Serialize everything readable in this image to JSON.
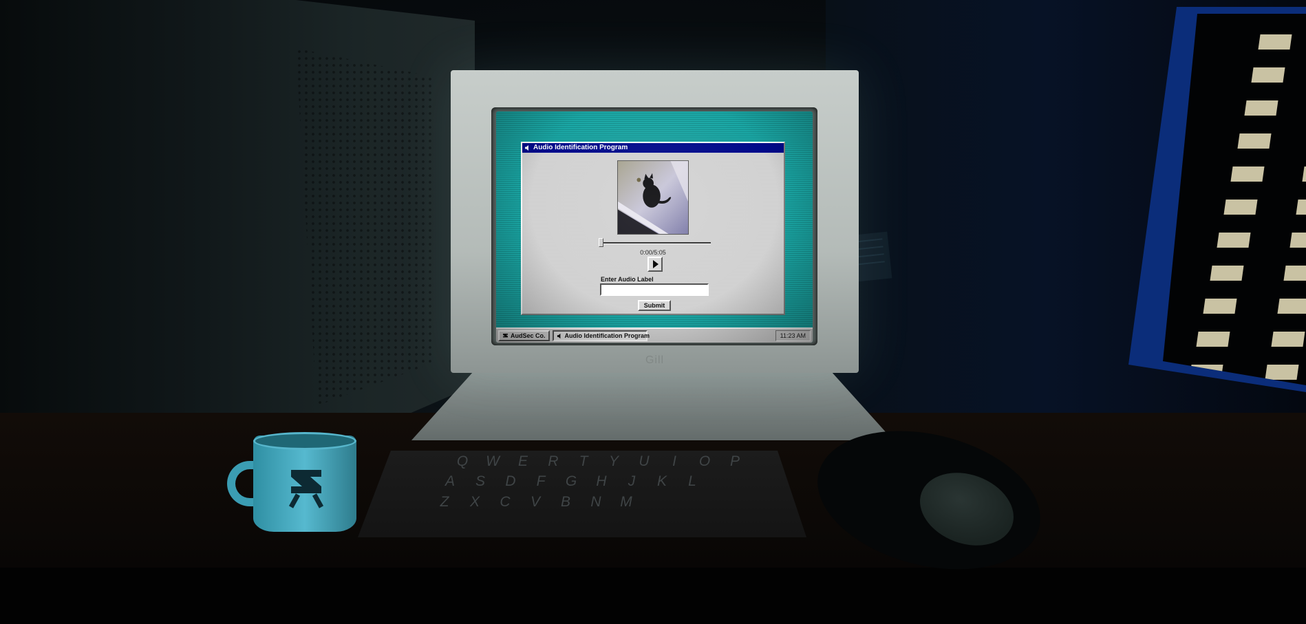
{
  "monitor": {
    "brand": "Gill"
  },
  "app": {
    "title": "Audio Identification Program",
    "title_icon": "speaker-icon",
    "time_display": "0:00/5:05",
    "progress": 0,
    "play_icon": "play-icon",
    "label_prompt": "Enter Audio Label",
    "label_value": "",
    "submit_label": "Submit",
    "preview_image": "black-cat-photo"
  },
  "taskbar": {
    "start_label": "AudSec Co.",
    "start_icon": "company-logo-icon",
    "task_label": "Audio Identification Program",
    "task_icon": "speaker-icon",
    "clock": "11:23 AM"
  },
  "keyboard": {
    "rows": [
      [
        "Q",
        "W",
        "E",
        "R",
        "T",
        "Y",
        "U",
        "I",
        "O",
        "P"
      ],
      [
        "A",
        "S",
        "D",
        "F",
        "G",
        "H",
        "J",
        "K",
        "L"
      ],
      [
        "Z",
        "X",
        "C",
        "V",
        "B",
        "N",
        "M"
      ]
    ]
  },
  "colors": {
    "desktop": "#1aa7a5",
    "titlebar": "#000a8a",
    "window_face": "#d4d4d4",
    "window_glow": "#0b2d7a",
    "mug": "#56b9cf"
  }
}
